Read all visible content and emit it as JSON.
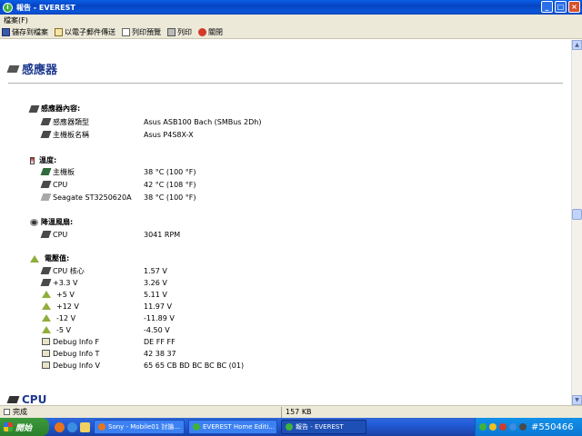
{
  "window": {
    "title": "報告 - EVEREST",
    "title_icon": "i"
  },
  "window_buttons": {
    "minimize": "_",
    "maximize": "□",
    "close": "×"
  },
  "menu": {
    "file": "檔案(F)"
  },
  "toolbar": {
    "save": "儲存到檔案",
    "email": "以電子郵件傳送",
    "preview": "列印預覽",
    "print": "列印",
    "close": "關閉"
  },
  "page": {
    "title": "感應器"
  },
  "sensor_props": {
    "heading": "感應器內容:",
    "rows": [
      {
        "label": "感應器類型",
        "value": "Asus ASB100 Bach (SMBus 2Dh)"
      },
      {
        "label": "主機板名稱",
        "value": "Asus P4S8X-X"
      }
    ]
  },
  "temperatures": {
    "heading": "溫度:",
    "rows": [
      {
        "label": "主機板",
        "value": "38 °C (100 °F)"
      },
      {
        "label": "CPU",
        "value": "42 °C (108 °F)"
      },
      {
        "label": "Seagate ST3250620A",
        "value": "38 °C (100 °F)"
      }
    ]
  },
  "fans": {
    "heading": "降溫風扇:",
    "rows": [
      {
        "label": "CPU",
        "value": "3041 RPM"
      }
    ]
  },
  "voltages": {
    "heading": "電壓值:",
    "rows": [
      {
        "label": "CPU 核心",
        "value": "1.57 V",
        "icon": "chip-icon"
      },
      {
        "label": "+3.3 V",
        "value": "3.26 V",
        "icon": "chip-icon"
      },
      {
        "label": "+5 V",
        "value": "5.11 V",
        "icon": "warning-icon"
      },
      {
        "label": "+12 V",
        "value": "11.97 V",
        "icon": "warning-icon"
      },
      {
        "label": "-12 V",
        "value": "-11.89 V",
        "icon": "warning-icon"
      },
      {
        "label": "-5 V",
        "value": "-4.50 V",
        "icon": "warning-icon"
      },
      {
        "label": "Debug Info F",
        "value": "DE FF FF",
        "icon": "debug-icon"
      },
      {
        "label": "Debug Info T",
        "value": "42 38 37",
        "icon": "debug-icon"
      },
      {
        "label": "Debug Info V",
        "value": "65 65 CB BD BC BC BC (01)",
        "icon": "debug-icon"
      }
    ]
  },
  "next_section": {
    "title": "CPU"
  },
  "statusbar": {
    "left": "完成",
    "size": "157 KB"
  },
  "taskbar": {
    "start": "開始",
    "tasks": [
      {
        "label": "Sony - Mobile01 討論..."
      },
      {
        "label": "EVEREST Home Editi..."
      },
      {
        "label": "報告 - EVEREST"
      }
    ],
    "clock": "#550466"
  }
}
